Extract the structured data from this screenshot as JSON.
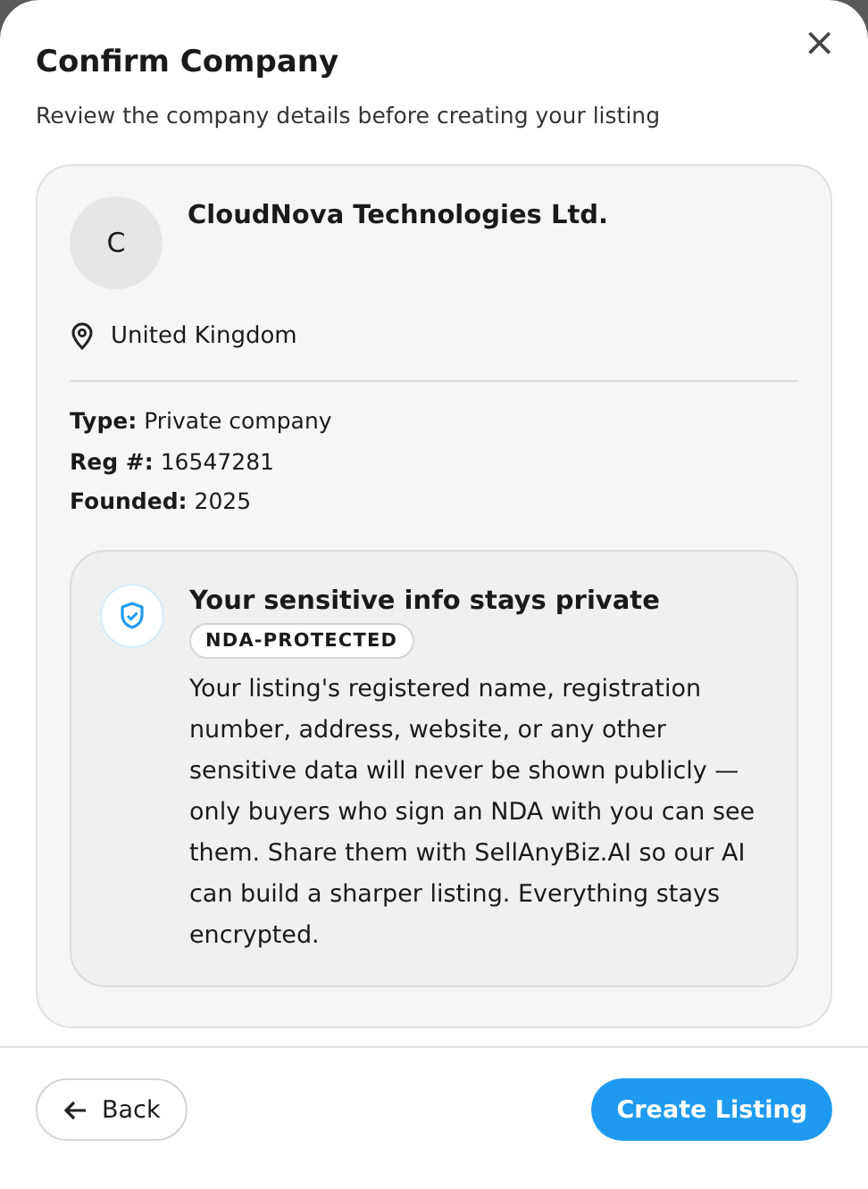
{
  "dialog": {
    "title": "Confirm Company",
    "subtitle": "Review the company details before creating your listing",
    "close_label": "×"
  },
  "company": {
    "avatar_letter": "C",
    "name": "CloudNova Technologies Ltd.",
    "location": "United Kingdom",
    "details": [
      {
        "label": "Type:",
        "value": "Private company"
      },
      {
        "label": "Reg #:",
        "value": "16547281"
      },
      {
        "label": "Founded:",
        "value": "2025"
      }
    ]
  },
  "privacy_notice": {
    "title": "Your sensitive info stays private",
    "badge": "NDA-PROTECTED",
    "body": "Your listing's registered name, registration number, address, website, or any other sensitive data will never be shown publicly — only buyers who sign an NDA with you can see them. Share them with SellAnyBiz.AI so our AI can build a sharper listing. Everything stays encrypted."
  },
  "buttons": [
    {
      "kind": "secondary",
      "label": "Back"
    },
    {
      "kind": "primary",
      "label": "Create Listing"
    }
  ]
}
